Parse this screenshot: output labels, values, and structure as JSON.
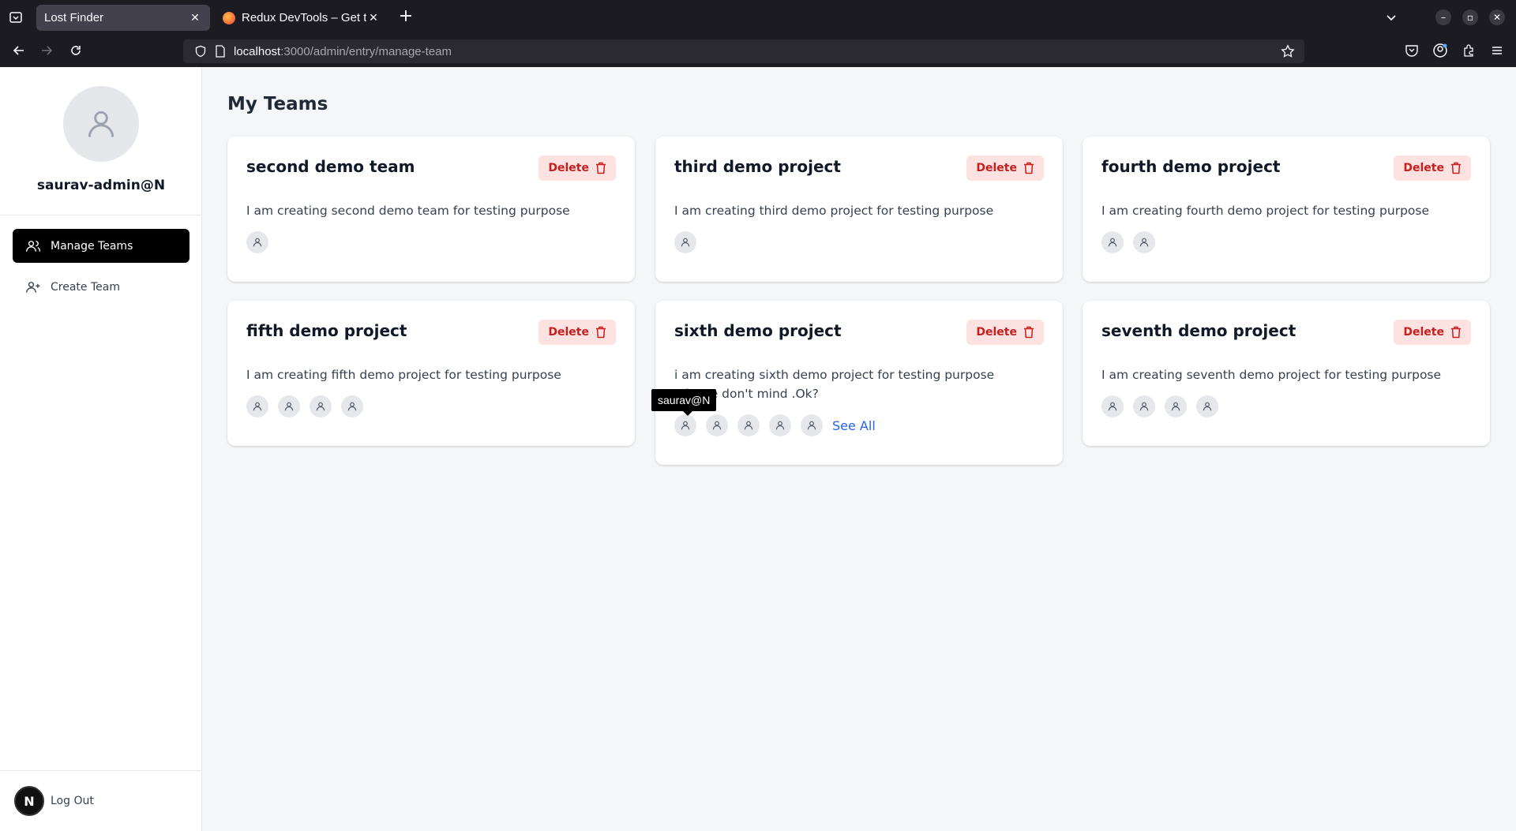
{
  "browser": {
    "tabs": [
      {
        "label": "Lost Finder",
        "active": true
      },
      {
        "label": "Redux DevTools – Get thi",
        "active": false
      }
    ],
    "url_host": "localhost",
    "url_path": ":3000/admin/entry/manage-team",
    "icons": [
      "list-all-tabs-icon",
      "close-tab-icon",
      "new-tab-icon",
      "tab-dropdown-icon",
      "minimize-icon",
      "restore-icon",
      "close-window-icon",
      "back-icon",
      "forward-icon",
      "reload-icon",
      "shield-icon",
      "page-icon",
      "bookmark-star-icon",
      "pocket-icon",
      "account-icon",
      "extensions-icon",
      "menu-icon"
    ]
  },
  "sidebar": {
    "profile_name": "saurav-admin@N",
    "items": [
      {
        "label": "Manage Teams",
        "icon": "users-icon",
        "active": true
      },
      {
        "label": "Create Team",
        "icon": "user-plus-icon",
        "active": false
      }
    ],
    "logout_logo": "N",
    "logout_label": "Log Out"
  },
  "main": {
    "title": "My Teams",
    "delete_label": "Delete",
    "see_all_label": "See All",
    "teams": [
      {
        "title": "second demo team",
        "description": "I am creating second demo team for testing purpose",
        "member_count": 1
      },
      {
        "title": "third demo project",
        "description": "I am creating third demo project for testing purpose",
        "member_count": 1
      },
      {
        "title": "fourth demo project",
        "description": "I am creating fourth demo project for testing purpose",
        "member_count": 2
      },
      {
        "title": "fifth demo project",
        "description": "I am creating fifth demo project for testing purpose",
        "member_count": 4
      },
      {
        "title": "sixth demo project",
        "description": "i am creating sixth demo project for testing purpose .Please don't mind .Ok?",
        "member_count": 5,
        "see_all": true
      },
      {
        "title": "seventh demo project",
        "description": "I am creating seventh demo project for testing purpose",
        "member_count": 4
      }
    ],
    "tooltip": "saurav@N"
  },
  "colors": {
    "chrome_bg": "#1c1b22",
    "active_nav": "#000000",
    "delete_bg": "#fde2e2",
    "delete_text": "#c81e1e",
    "link": "#2563eb"
  }
}
